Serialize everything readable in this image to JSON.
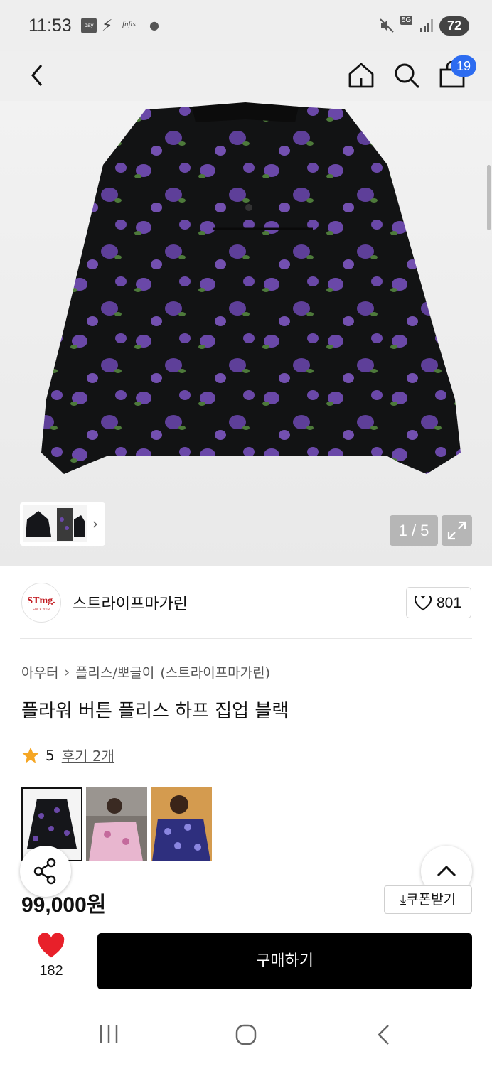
{
  "status_bar": {
    "time": "11:53",
    "pay_label": "pay",
    "brand_icon_text": "fnfts",
    "network": "5G",
    "battery": "72"
  },
  "header": {
    "cart_count": "19"
  },
  "gallery": {
    "page_indicator": "1 / 5"
  },
  "store": {
    "logo_text": "STmg.",
    "logo_subtext": "SINCE 2018",
    "name": "스트라이프마가린",
    "like_count": "801"
  },
  "product": {
    "breadcrumb": [
      "아우터",
      "플리스/뽀글이",
      "(스트라이프마가린)"
    ],
    "title": "플라워 버튼 플리스 하프 집업 블랙",
    "rating": "5",
    "review_link": "후기 2개",
    "price": "99,000원",
    "coupon_label": "쿠폰받기"
  },
  "bottom_bar": {
    "wish_count": "182",
    "buy_label": "구매하기"
  },
  "colors": {
    "accent_blue": "#2d6cf0",
    "heart_red": "#e8202a",
    "star": "#f5a623",
    "buy_button": "#000000"
  },
  "icons": [
    "back-icon",
    "home-icon",
    "search-icon",
    "shopping-bag-icon",
    "expand-icon",
    "heart-outline-icon",
    "star-icon",
    "share-icon",
    "chevron-up-icon",
    "download-icon",
    "heart-filled-icon"
  ]
}
